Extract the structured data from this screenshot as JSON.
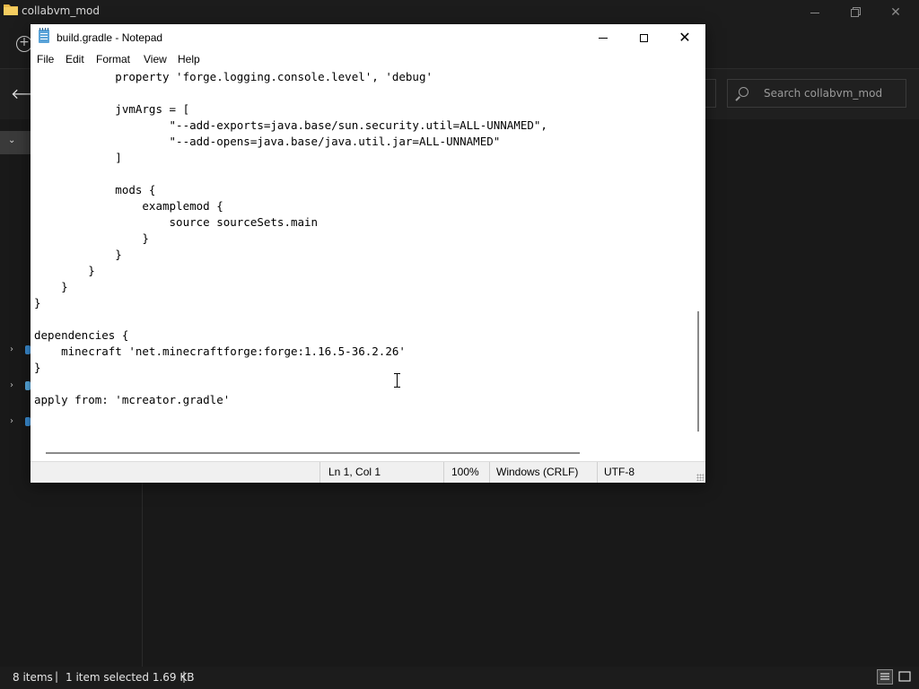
{
  "explorer": {
    "title": "collabvm_mod",
    "search_placeholder": "Search collabvm_mod",
    "status": {
      "item_count": "8 items",
      "selection": "1 item selected  1.69 KB"
    },
    "icons": {
      "folder": "folder-icon",
      "back": "back-arrow-icon",
      "search": "search-icon",
      "new": "new-plus-icon",
      "details_view": "details-view-icon",
      "tiles_view": "tiles-view-icon"
    }
  },
  "notepad": {
    "title": "build.gradle - Notepad",
    "menu": [
      "File",
      "Edit",
      "Format",
      "View",
      "Help"
    ],
    "content": "            property 'forge.logging.console.level', 'debug'\n\n            jvmArgs = [\n                    \"--add-exports=java.base/sun.security.util=ALL-UNNAMED\",\n                    \"--add-opens=java.base/java.util.jar=ALL-UNNAMED\"\n            ]\n\n            mods {\n                examplemod {\n                    source sourceSets.main\n                }\n            }\n        }\n    }\n}\n\ndependencies {\n    minecraft 'net.minecraftforge:forge:1.16.5-36.2.26'\n}\n\napply from: 'mcreator.gradle'",
    "status": {
      "position": "Ln 1, Col 1",
      "zoom": "100%",
      "line_ending": "Windows (CRLF)",
      "encoding": "UTF-8"
    }
  },
  "colors": {
    "explorer_bg": "#191919",
    "notepad_bg": "#ffffff",
    "folder_yellow": "#e8b84a",
    "notepad_icon": "#5aa3d8"
  }
}
